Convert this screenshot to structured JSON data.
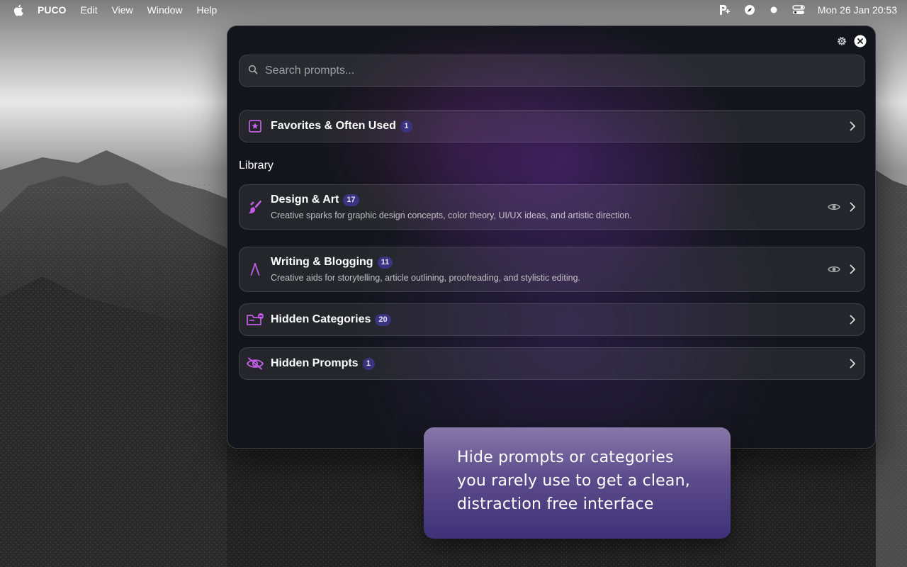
{
  "menubar": {
    "apple_icon": "apple-logo-icon",
    "app_name": "PUCO",
    "menus": [
      "Edit",
      "View",
      "Window",
      "Help"
    ],
    "status_icons": [
      "puco-prompt-icon",
      "compass-icon",
      "record-dot-icon",
      "control-center-icon"
    ],
    "datetime": "Mon 26 Jan  20:53"
  },
  "window": {
    "controls": [
      "settings-gear-icon",
      "close-icon"
    ],
    "search": {
      "placeholder": "Search prompts...",
      "value": ""
    },
    "favorites": {
      "title": "Favorites & Often Used",
      "count": "1",
      "icon": "star-square-icon"
    },
    "library_label": "Library",
    "categories": [
      {
        "title": "Design & Art",
        "count": "17",
        "description": "Creative sparks for graphic design concepts, color theory, UI/UX ideas, and artistic direction.",
        "icon": "paintbrush-icon"
      },
      {
        "title": "Writing & Blogging",
        "count": "11",
        "description": "Creative aids for storytelling, article outlining, proofreading, and stylistic editing.",
        "icon": "pen-nib-icon"
      }
    ],
    "hidden_categories": {
      "title": "Hidden Categories",
      "count": "20",
      "icon": "folder-hidden-icon"
    },
    "hidden_prompts": {
      "title": "Hidden Prompts",
      "count": "1",
      "icon": "eye-slash-icon"
    }
  },
  "callout": {
    "lines": [
      "Hide prompts or categories",
      "you rarely use to get a clean,",
      "distraction free interface"
    ]
  },
  "colors": {
    "accent": "#c45ee8",
    "badge": "#3a3480",
    "callout_top": "#8878a8",
    "callout_bottom": "#3e3177"
  }
}
